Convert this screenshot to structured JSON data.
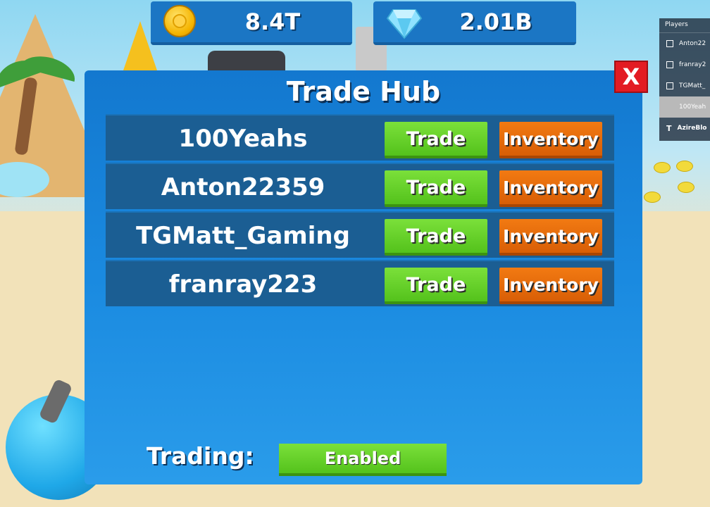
{
  "currencies": {
    "coins": {
      "amount": "8.4T",
      "icon": "gold-coin-icon"
    },
    "gems": {
      "amount": "2.01B",
      "icon": "diamond-gem-icon"
    }
  },
  "players_panel": {
    "title": "Players",
    "entries": [
      "Anton22",
      "franray2",
      "TGMatt_",
      "100Yeah",
      "AzireBlo"
    ]
  },
  "close_button": {
    "label": "X"
  },
  "trade_hub": {
    "title": "Trade Hub",
    "rows": [
      {
        "name": "100Yeahs",
        "trade_label": "Trade",
        "inventory_label": "Inventory"
      },
      {
        "name": "Anton22359",
        "trade_label": "Trade",
        "inventory_label": "Inventory"
      },
      {
        "name": "TGMatt_Gaming",
        "trade_label": "Trade",
        "inventory_label": "Inventory"
      },
      {
        "name": "franray223",
        "trade_label": "Trade",
        "inventory_label": "Inventory"
      }
    ],
    "trading_label": "Trading:",
    "trading_status": "Enabled"
  },
  "colors": {
    "panel_blue": "#1a8ae0",
    "row_blue": "#1b5e93",
    "trade_green": "#54c21c",
    "inventory_orange": "#d85e06",
    "close_red": "#e31b23"
  }
}
